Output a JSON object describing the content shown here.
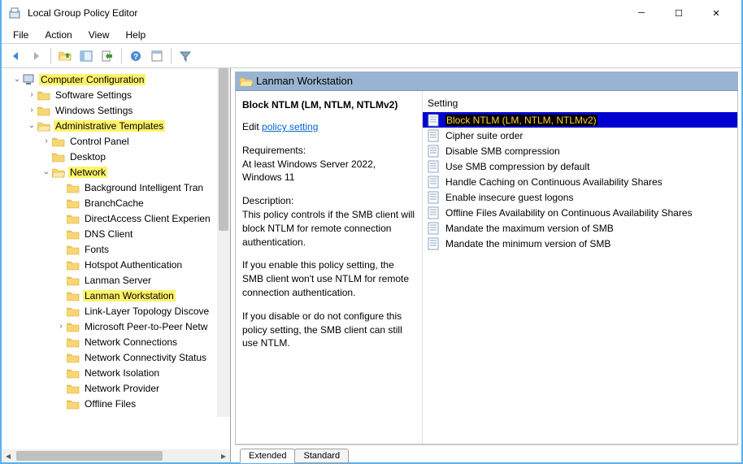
{
  "window": {
    "title": "Local Group Policy Editor"
  },
  "menu": {
    "file": "File",
    "action": "Action",
    "view": "View",
    "help": "Help"
  },
  "tree": {
    "root": "Computer Configuration",
    "software": "Software Settings",
    "windows": "Windows Settings",
    "admin": "Administrative Templates",
    "cpanel": "Control Panel",
    "desktop": "Desktop",
    "network": "Network",
    "net_items": [
      "Background Intelligent Tran",
      "BranchCache",
      "DirectAccess Client Experien",
      "DNS Client",
      "Fonts",
      "Hotspot Authentication",
      "Lanman Server",
      "Lanman Workstation",
      "Link-Layer Topology Discove",
      "Microsoft Peer-to-Peer Netw",
      "Network Connections",
      "Network Connectivity Status",
      "Network Isolation",
      "Network Provider",
      "Offline Files"
    ]
  },
  "detail": {
    "header": "Lanman Workstation",
    "policy_name": "Block NTLM (LM, NTLM, NTLMv2)",
    "edit_prefix": "Edit ",
    "edit_link": "policy setting",
    "req_label": "Requirements:",
    "req_text": "At least Windows Server 2022, Windows 11",
    "desc_label": "Description:",
    "desc_p1": "This policy controls if the SMB client will block NTLM for remote connection authentication.",
    "desc_p2": "If you enable this policy setting, the SMB client won't use NTLM for remote connection authentication.",
    "desc_p3": "If you disable or do not configure this policy setting, the SMB client can still use NTLM.",
    "settings_header": "Setting",
    "settings": [
      "Block NTLM (LM, NTLM, NTLMv2)",
      "Cipher suite order",
      "Disable SMB compression",
      "Use SMB compression by default",
      "Handle Caching on Continuous Availability Shares",
      "Enable insecure guest logons",
      "Offline Files Availability on Continuous Availability Shares",
      "Mandate the maximum version of SMB",
      "Mandate the minimum version of SMB"
    ]
  },
  "tabs": {
    "extended": "Extended",
    "standard": "Standard"
  }
}
